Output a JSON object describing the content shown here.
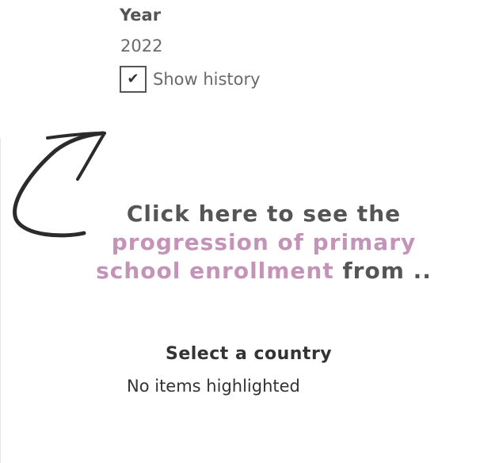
{
  "year_filter": {
    "title": "Year",
    "value": "2022"
  },
  "history_toggle": {
    "checked": true,
    "mark": "✔",
    "label": "Show history"
  },
  "arrow": {
    "icon": "curved-arrow-up-right-icon",
    "color": "#2b2b2b"
  },
  "callout": {
    "line1": "Click here to see the",
    "accent_line2": "progression of primary",
    "accent_line3_part1": "school enrollment",
    "line3_part2": " from ..",
    "accent_color": "#c393b8"
  },
  "country_select": {
    "title": "Select a country",
    "status": "No items highlighted"
  }
}
